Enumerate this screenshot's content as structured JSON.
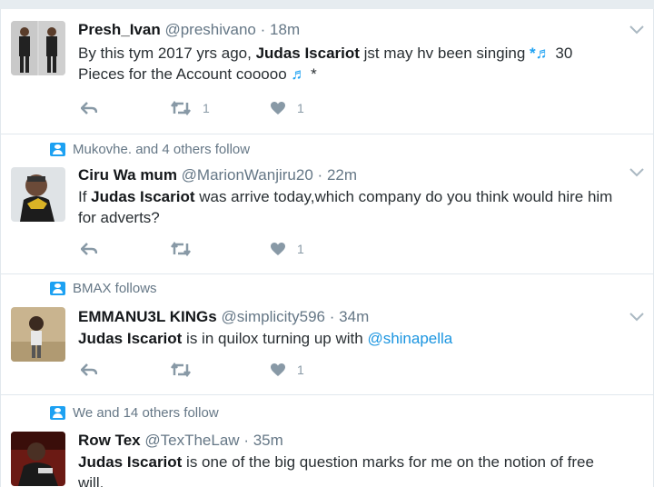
{
  "tweets": [
    {
      "context": "",
      "name": "Presh_Ivan",
      "handle": "@preshivano",
      "separator": "·",
      "time": "18m",
      "text_1": "By this tym 2017 yrs ago, ",
      "bold_1": "Judas Iscariot",
      "text_2": " jst may hv been singing ",
      "music_1": "*♬",
      "text_3": " 30 Pieces for the Account cooooo ",
      "music_2": "♬",
      "text_4": " *",
      "retweets": "1",
      "likes": "1"
    },
    {
      "context": "Mukovhe. and 4 others follow",
      "name": "Ciru Wa mum",
      "handle": "@MarionWanjiru20",
      "separator": "·",
      "time": "22m",
      "text_1": "If ",
      "bold_1": "Judas Iscariot",
      "text_2": " was arrive today,which company do you think would hire him for adverts?",
      "retweets": "",
      "likes": "1"
    },
    {
      "context": "BMAX follows",
      "name": "EMMANU3L KINGs",
      "handle": "@simplicity596",
      "separator": "·",
      "time": "34m",
      "bold_1": "Judas Iscariot",
      "text_1": " is in quilox turning up with ",
      "mention": "@shinapella",
      "retweets": "",
      "likes": "1"
    },
    {
      "context": "We and 14 others follow",
      "name": "Row Tex",
      "handle": "@TexTheLaw",
      "separator": "·",
      "time": "35m",
      "bold_1": "Judas Iscariot",
      "text_1": " is one of the big question marks for me on the notion of free will."
    }
  ],
  "icons": {
    "context": "follow-person-icon",
    "menu": "chevron-down-icon",
    "reply": "reply-icon",
    "retweet": "retweet-icon",
    "like": "heart-icon"
  },
  "colors": {
    "accent": "#1da1f2",
    "link": "#1b95e0",
    "muted": "#657786",
    "action": "#8899a6"
  }
}
